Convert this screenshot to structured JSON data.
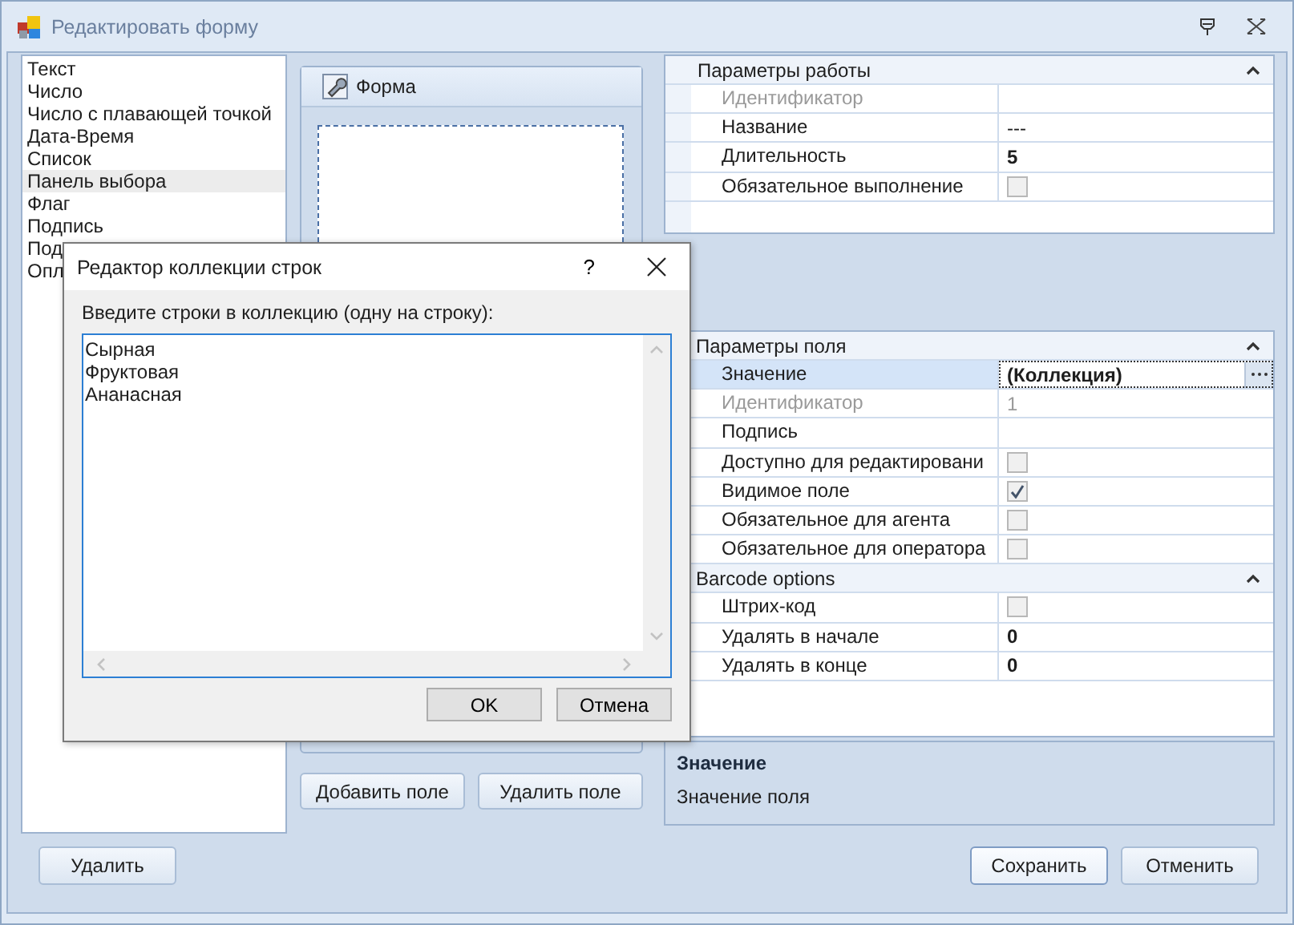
{
  "window": {
    "title": "Редактировать форму"
  },
  "field_types": [
    {
      "label": "Текст",
      "selected": false
    },
    {
      "label": "Число",
      "selected": false
    },
    {
      "label": "Число с плавающей точкой",
      "selected": false
    },
    {
      "label": "Дата-Время",
      "selected": false
    },
    {
      "label": "Список",
      "selected": false
    },
    {
      "label": "Панель выбора",
      "selected": true
    },
    {
      "label": "Флаг",
      "selected": false
    },
    {
      "label": "Подпись",
      "selected": false
    },
    {
      "label": "Под",
      "selected": false
    },
    {
      "label": "Опл",
      "selected": false
    }
  ],
  "form_panel": {
    "title": "Форма",
    "buttons": [
      "Добавить поле",
      "Удалить поле"
    ]
  },
  "work_properties": {
    "sections": [
      {
        "title": "Параметры работы",
        "rows": [
          {
            "name": "Идентификатор",
            "kind": "text",
            "disabled": true,
            "selected": false
          },
          {
            "name": "Название",
            "kind": "text",
            "value": "---",
            "bold": false,
            "disabled": false,
            "selected": false
          },
          {
            "name": "Длительность",
            "kind": "text",
            "value": "5",
            "bold": true,
            "disabled": false,
            "selected": false
          },
          {
            "name": "Обязательное выполнение",
            "kind": "check",
            "checked": false,
            "disabled": false,
            "selected": false
          }
        ]
      }
    ]
  },
  "field_properties": {
    "sections": [
      {
        "title": "Параметры поля",
        "rows": [
          {
            "name": "Значение",
            "kind": "collection",
            "value": "(Коллекция)",
            "bold": true,
            "disabled": false,
            "selected": true
          },
          {
            "name": "Идентификатор",
            "kind": "text",
            "value": "1",
            "bold": false,
            "disabled": true,
            "selected": false
          },
          {
            "name": "Подпись",
            "kind": "text",
            "disabled": false,
            "selected": false
          },
          {
            "name": "Доступно для редактировани",
            "kind": "check",
            "checked": false,
            "disabled": false,
            "selected": false
          },
          {
            "name": "Видимое поле",
            "kind": "check",
            "checked": true,
            "disabled": false,
            "selected": false
          },
          {
            "name": "Обязательное для агента",
            "kind": "check",
            "checked": false,
            "disabled": false,
            "selected": false
          },
          {
            "name": "Обязательное для оператора",
            "kind": "check",
            "checked": false,
            "disabled": false,
            "selected": false
          }
        ]
      },
      {
        "title": "Barcode options",
        "rows": [
          {
            "name": "Штрих-код",
            "kind": "check",
            "checked": false,
            "disabled": false,
            "selected": false
          },
          {
            "name": "Удалять в начале",
            "kind": "text",
            "value": "0",
            "bold": true,
            "disabled": false,
            "selected": false
          },
          {
            "name": "Удалять в конце",
            "kind": "text",
            "value": "0",
            "bold": true,
            "disabled": false,
            "selected": false
          }
        ]
      }
    ]
  },
  "description": {
    "title": "Значение",
    "text": "Значение поля"
  },
  "footer_buttons": [
    {
      "label": "Удалить",
      "default": false
    },
    {
      "label": "Сохранить",
      "default": true
    },
    {
      "label": "Отменить",
      "default": false
    }
  ],
  "dialog": {
    "title": "Редактор коллекции строк",
    "help": "?",
    "prompt": "Введите строки в коллекцию (одну на строку):",
    "lines": [
      "Сырная",
      "Фруктовая",
      "Ананасная"
    ],
    "buttons": [
      "OK",
      "Отмена"
    ]
  }
}
